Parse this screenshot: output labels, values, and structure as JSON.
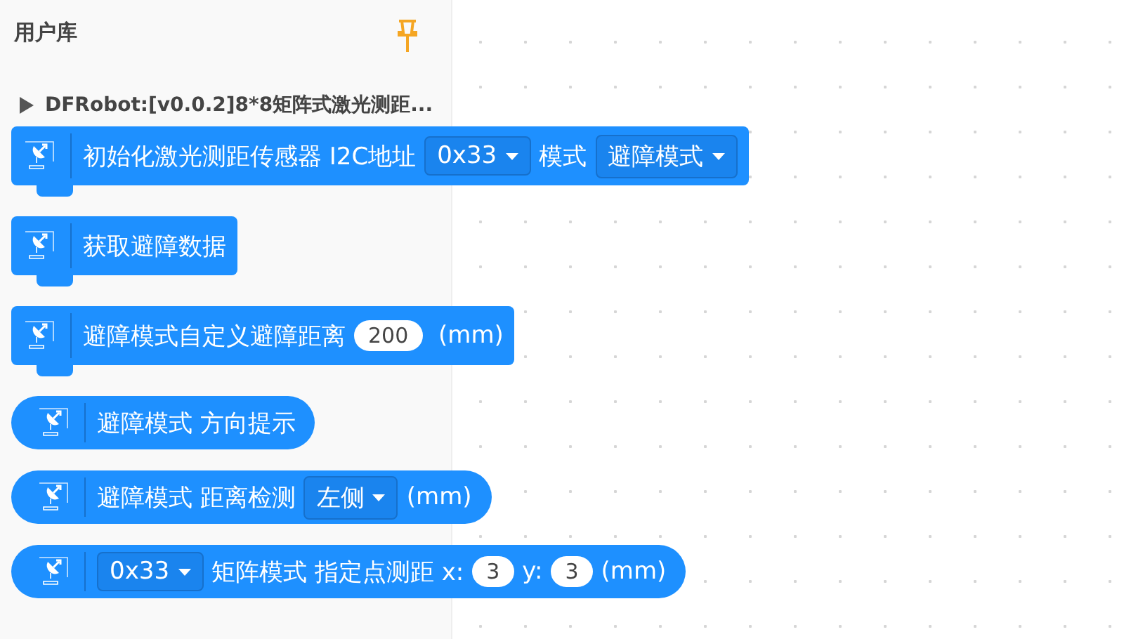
{
  "sidebar": {
    "title": "用户库",
    "pinned": true,
    "category": {
      "label": "DFRobot:[v0.0.2]8*8矩阵式激光测距...",
      "expanded": true
    },
    "blocks": [
      {
        "kind": "command",
        "parts": [
          {
            "kind": "text",
            "text": "初始化激光测距传感器 I2C地址"
          },
          {
            "kind": "dropdown",
            "text": "0x33"
          },
          {
            "kind": "text",
            "text": "模式"
          },
          {
            "kind": "dropdown",
            "text": "避障模式"
          }
        ]
      },
      {
        "kind": "command",
        "parts": [
          {
            "kind": "text",
            "text": "获取避障数据"
          }
        ]
      },
      {
        "kind": "command",
        "parts": [
          {
            "kind": "text",
            "text": "避障模式自定义避障距离"
          },
          {
            "kind": "number",
            "text": "200"
          },
          {
            "kind": "text",
            "text": " (mm)"
          }
        ]
      },
      {
        "kind": "reporter",
        "parts": [
          {
            "kind": "text",
            "text": "避障模式 方向提示"
          }
        ]
      },
      {
        "kind": "reporter",
        "parts": [
          {
            "kind": "text",
            "text": "避障模式 距离检测"
          },
          {
            "kind": "dropdown",
            "text": "左侧"
          },
          {
            "kind": "text",
            "text": "(mm)"
          }
        ]
      },
      {
        "kind": "reporter",
        "parts": [
          {
            "kind": "dropdown",
            "text": "0x33"
          },
          {
            "kind": "text",
            "text": "矩阵模式 指定点测距 x:"
          },
          {
            "kind": "number",
            "text": "3"
          },
          {
            "kind": "text",
            "text": "y:"
          },
          {
            "kind": "number",
            "text": "3"
          },
          {
            "kind": "text",
            "text": "(mm)"
          }
        ]
      }
    ]
  }
}
